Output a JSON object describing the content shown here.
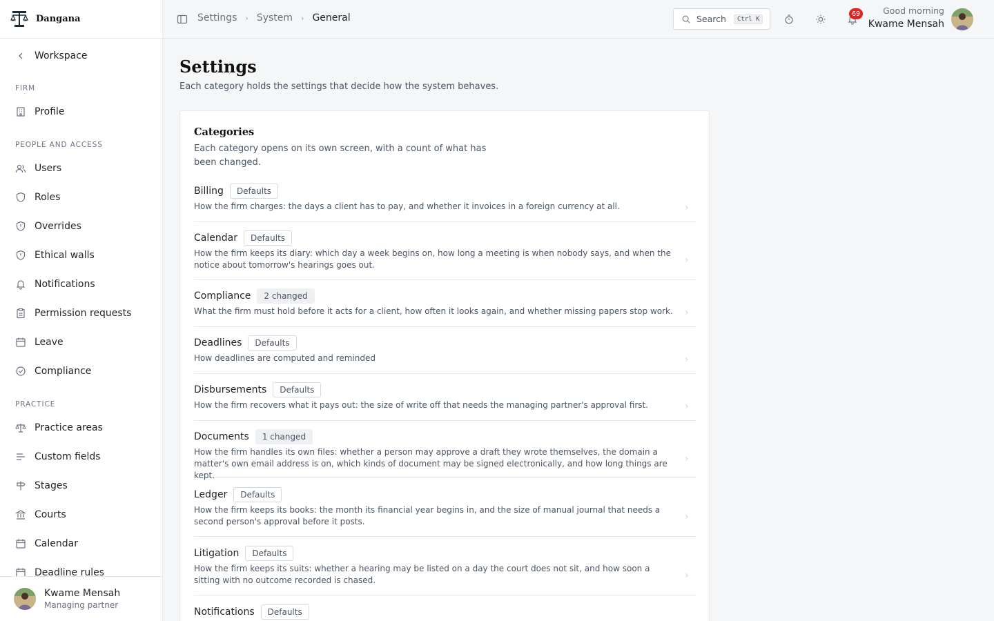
{
  "brand": {
    "name": "Dangana"
  },
  "sidebar": {
    "back_label": "Workspace",
    "sections": [
      {
        "title": "FIRM",
        "items": [
          {
            "label": "Profile",
            "icon": "building-icon"
          }
        ]
      },
      {
        "title": "PEOPLE AND ACCESS",
        "items": [
          {
            "label": "Users",
            "icon": "users-icon"
          },
          {
            "label": "Roles",
            "icon": "shield-icon"
          },
          {
            "label": "Overrides",
            "icon": "shield-alert-icon"
          },
          {
            "label": "Ethical walls",
            "icon": "shield-alert-icon"
          },
          {
            "label": "Notifications",
            "icon": "bell-icon"
          },
          {
            "label": "Permission requests",
            "icon": "clipboard-icon"
          },
          {
            "label": "Leave",
            "icon": "calendar-icon"
          },
          {
            "label": "Compliance",
            "icon": "check-circle-icon"
          }
        ]
      },
      {
        "title": "PRACTICE",
        "items": [
          {
            "label": "Practice areas",
            "icon": "scale-icon"
          },
          {
            "label": "Custom fields",
            "icon": "list-icon"
          },
          {
            "label": "Stages",
            "icon": "signpost-icon"
          },
          {
            "label": "Courts",
            "icon": "landmark-icon"
          },
          {
            "label": "Calendar",
            "icon": "calendar-icon"
          },
          {
            "label": "Deadline rules",
            "icon": "calendar-clock-icon"
          }
        ]
      }
    ],
    "footer": {
      "name": "Kwame Mensah",
      "role": "Managing partner"
    }
  },
  "topbar": {
    "breadcrumb": [
      "Settings",
      "System",
      "General"
    ],
    "search_label": "Search",
    "search_shortcut": "Ctrl K",
    "notification_count": "69",
    "greeting": "Good morning",
    "user_name": "Kwame Mensah"
  },
  "main": {
    "title": "Settings",
    "subtitle": "Each category holds the settings that decide how the system behaves.",
    "card_title": "Categories",
    "card_subtitle": "Each category opens on its own screen, with a count of what has been changed.",
    "categories": [
      {
        "name": "Billing",
        "status": "Defaults",
        "description": "How the firm charges: the days a client has to pay, and whether it invoices in a foreign currency at all."
      },
      {
        "name": "Calendar",
        "status": "Defaults",
        "description": "How the firm keeps its diary: which day a week begins on, how long a meeting is when nobody says, and when the notice about tomorrow's hearings goes out."
      },
      {
        "name": "Compliance",
        "status": "2 changed",
        "description": "What the firm must hold before it acts for a client, how often it looks again, and whether missing papers stop work."
      },
      {
        "name": "Deadlines",
        "status": "Defaults",
        "description": "How deadlines are computed and reminded"
      },
      {
        "name": "Disbursements",
        "status": "Defaults",
        "description": "How the firm recovers what it pays out: the size of write off that needs the managing partner's approval first."
      },
      {
        "name": "Documents",
        "status": "1 changed",
        "description": "How the firm handles its own files: whether a person may approve a draft they wrote themselves, the domain a matter's own email address is on, which kinds of document may be signed electronically, and how long things are kept."
      },
      {
        "name": "Ledger",
        "status": "Defaults",
        "description": "How the firm keeps its books: the month its financial year begins in, and the size of manual journal that needs a second person's approval before it posts."
      },
      {
        "name": "Litigation",
        "status": "Defaults",
        "description": "How the firm keeps its suits: whether a hearing may be listed on a day the court does not sit, and how soon a sitting with no outcome recorded is chased."
      },
      {
        "name": "Notifications",
        "status": "Defaults",
        "description": ""
      }
    ]
  },
  "colors": {
    "badge": "#e02424",
    "text": "#1f2328",
    "muted": "#6b7280",
    "border": "#e6e8ea",
    "background": "#f4f6f7"
  }
}
